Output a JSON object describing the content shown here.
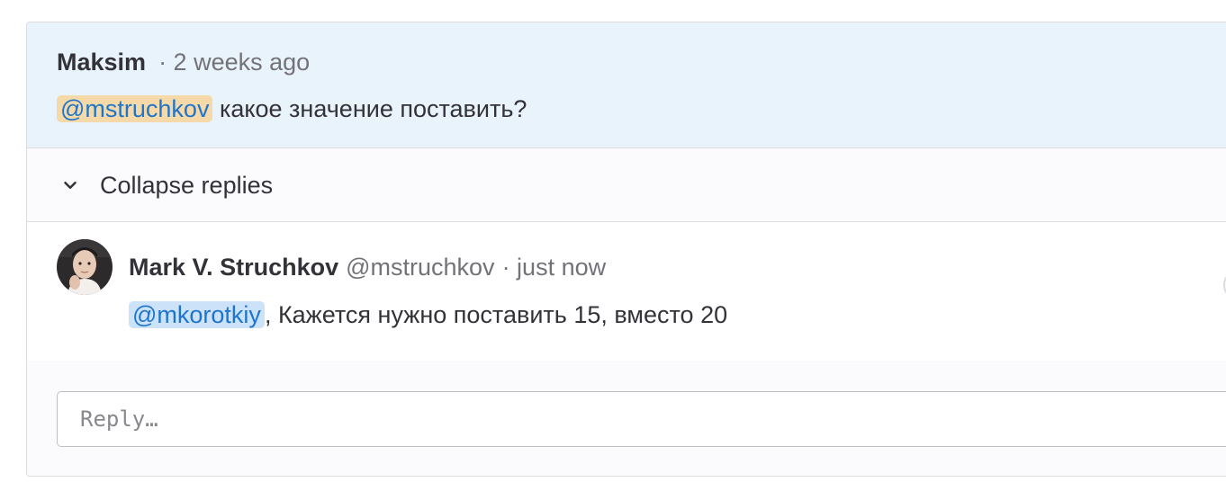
{
  "discussion": {
    "original_note": {
      "author": "Maksim",
      "meta": "· 2 weeks ago",
      "mention": "@mstruchkov",
      "text": " какое значение поставить?"
    },
    "collapse": {
      "label": "Collapse replies",
      "icon": "chevron-down-icon"
    },
    "reply": {
      "author": "Mark V. Struchkov",
      "handle": "@mstruchkov",
      "meta": "· just now",
      "mention": "@mkorotkiy",
      "text": ", Кажется нужно поставить 15, вместо 20",
      "avatar": "avatar-image"
    },
    "reply_field": {
      "placeholder": "Reply…"
    }
  },
  "colors": {
    "highlight_bg": "#e9f3fc",
    "mention_link": "#1f75cb",
    "mention_self_bg": "#f5d9a8",
    "mention_other_bg": "#cbe2f9",
    "border": "#dcdcde"
  }
}
